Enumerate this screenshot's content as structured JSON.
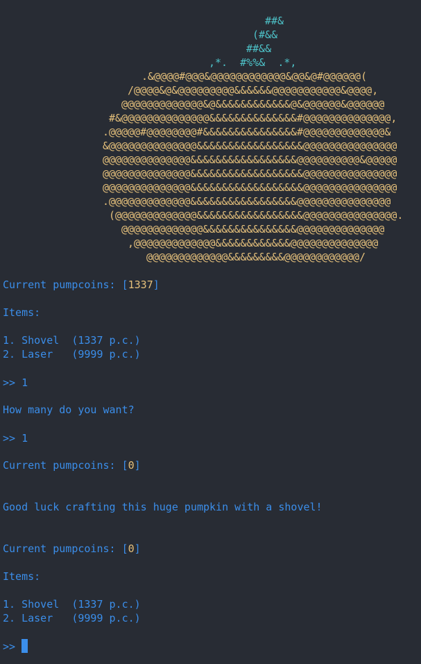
{
  "ascii_art": {
    "teal_lines": [
      "##&",
      "(#&&",
      "##&&",
      ",*.  #%%&  .*,"
    ],
    "orange_lines": [
      ".&@@@@#@@@&@@@@@@@@@@@@&@@&@#@@@@@@(",
      "/@@@@&@&@@@@@@@@@&&&&&&@@@@@@@@@@@&@@@@,",
      "@@@@@@@@@@@@@&@&&&&&&&&&&&&@&@@@@@@&@@@@@@",
      "#&@@@@@@@@@@@@@@&&&&&&&&&&&&&&#@@@@@@@@@@@@@@,",
      ".@@@@@#@@@@@@@@#&&&&&&&&&&&&&&&#@@@@@@@@@@@@@&",
      "&@@@@@@@@@@@@@@&&&&&&&&&&&&&&&&&@@@@@@@@@@@@@@@",
      "@@@@@@@@@@@@@@&&&&&&&&&&&&&&&&&@@@@@@@@@@&@@@@@",
      "@@@@@@@@@@@@@@&&&&&&&&&&&&&&&&&&@@@@@@@@@@@@@@@",
      "@@@@@@@@@@@@@@&&&&&&&&&&&&&&&&&&@@@@@@@@@@@@@@@",
      ".@@@@@@@@@@@@@&&&&&&&&&&&&&&&&&@@@@@@@@@@@@@@@",
      "(@@@@@@@@@@@@@&&&&&&&&&&&&&&&&&@@@@@@@@@@@@@@@.",
      "@@@@@@@@@@@@@&&&&&&&&&&&&&&&@@@@@@@@@@@@@@",
      ",@@@@@@@@@@@@@&&&&&&&&&&&&@@@@@@@@@@@@@@",
      "@@@@@@@@@@@@@&&&&&&&&&@@@@@@@@@@@@/"
    ]
  },
  "session": {
    "coins_label": "Current pumpcoins: ",
    "coins_initial": "1337",
    "coins_after": "0",
    "items_header": "Items:",
    "items": [
      {
        "label": "1. Shovel  (1337 p.c.)"
      },
      {
        "label": "2. Laser   (9999 p.c.)"
      }
    ],
    "prompt": ">> ",
    "choice_input": "1",
    "quantity_question": "How many do you want?",
    "quantity_input": "1",
    "message": "Good luck crafting this huge pumpkin with a shovel!"
  },
  "colors": {
    "background": "#282c34",
    "text_blue": "#3b8eea",
    "art_teal": "#4ec3c9",
    "art_orange": "#e5c07b"
  }
}
